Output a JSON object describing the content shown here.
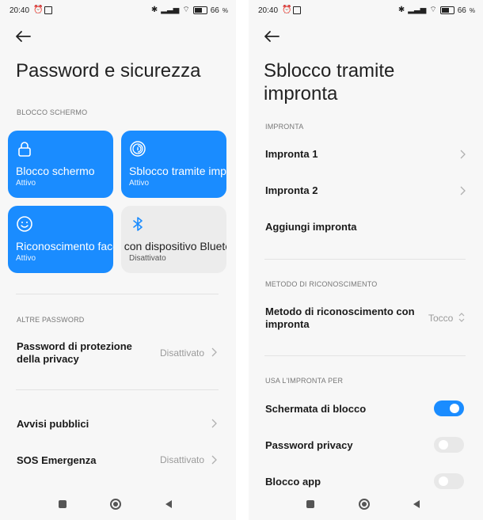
{
  "status": {
    "time": "20:40",
    "battery": "66"
  },
  "left": {
    "title": "Password e sicurezza",
    "section_blocco": "BLOCCO SCHERMO",
    "tiles": [
      {
        "label": "Blocco schermo",
        "status": "Attivo",
        "icon": "lock-icon"
      },
      {
        "label": "Sblocco tramite impronta",
        "status": "Attivo",
        "icon": "fingerprint-icon"
      },
      {
        "label": "Riconoscimento facciale",
        "status": "Attivo",
        "icon": "face-icon"
      },
      {
        "label": "Sblocco con dispositivo Bluetooth",
        "status": "Disattivato",
        "icon": "bluetooth-icon"
      }
    ],
    "section_altre": "ALTRE PASSWORD",
    "rows": [
      {
        "label": "Password di protezione della privacy",
        "value": "Disattivato"
      },
      {
        "label": "Avvisi pubblici",
        "value": ""
      },
      {
        "label": "SOS Emergenza",
        "value": "Disattivato"
      }
    ]
  },
  "right": {
    "title": "Sblocco tramite impronta",
    "section_impronta": "IMPRONTA",
    "fingerprints": [
      {
        "label": "Impronta 1"
      },
      {
        "label": "Impronta 2"
      }
    ],
    "add_label": "Aggiungi impronta",
    "section_metodo": "METODO DI RICONOSCIMENTO",
    "metodo_label": "Metodo di riconoscimento con impronta",
    "metodo_value": "Tocco",
    "section_usa": "USA L'IMPRONTA PER",
    "toggles": [
      {
        "label": "Schermata di blocco",
        "on": true
      },
      {
        "label": "Password privacy",
        "on": false
      },
      {
        "label": "Blocco app",
        "on": false
      }
    ]
  },
  "colors": {
    "accent": "#1a8cff",
    "tile_grey": "#ececec",
    "background": "#f7f7f7"
  }
}
